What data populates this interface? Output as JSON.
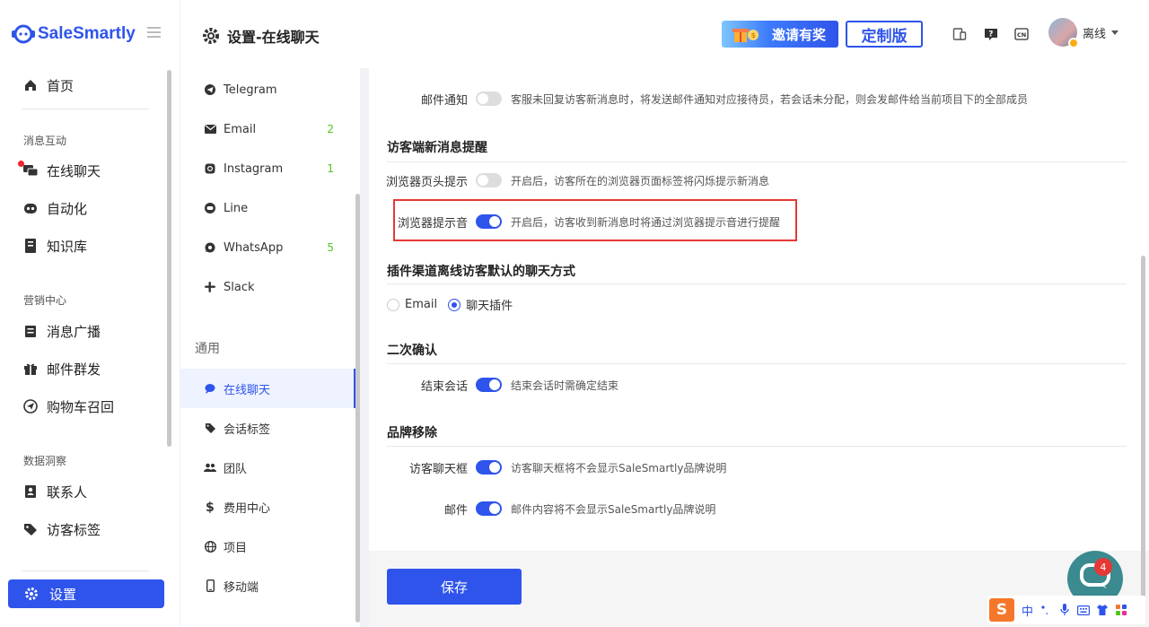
{
  "app": {
    "logo_text": "SaleSmartly",
    "brand_color": "#2f54eb"
  },
  "nav": {
    "home": "首页",
    "section_messaging": "消息互动",
    "live_chat": "在线聊天",
    "automation": "自动化",
    "knowledge": "知识库",
    "section_marketing": "营销中心",
    "broadcast": "消息广播",
    "mass_email": "邮件群发",
    "cart_recovery": "购物车召回",
    "section_data": "数据洞察",
    "contacts": "联系人",
    "visitor_tags": "访客标签",
    "settings": "设置"
  },
  "header": {
    "title": "设置-在线聊天",
    "invite_label": "邀请有奖",
    "custom_label": "定制版",
    "user_status": "离线"
  },
  "submenu": {
    "items": [
      {
        "label": "Telegram",
        "count": ""
      },
      {
        "label": "Email",
        "count": "2"
      },
      {
        "label": "Instagram",
        "count": "1"
      },
      {
        "label": "Line",
        "count": ""
      },
      {
        "label": "WhatsApp",
        "count": "5"
      },
      {
        "label": "Slack",
        "count": ""
      }
    ],
    "general_section": "通用",
    "general": [
      {
        "label": "在线聊天"
      },
      {
        "label": "会话标签"
      },
      {
        "label": "团队"
      },
      {
        "label": "费用中心"
      },
      {
        "label": "项目"
      },
      {
        "label": "移动端"
      }
    ]
  },
  "content": {
    "email_notify": {
      "label": "邮件通知",
      "desc": "客服未回复访客新消息时，将发送邮件通知对应接待员，若会话未分配，则会发邮件给当前项目下的全部成员",
      "on": false
    },
    "visitor_section": "访客端新消息提醒",
    "browser_tab": {
      "label": "浏览器页头提示",
      "desc": "开启后，访客所在的浏览器页面标签将闪烁提示新消息",
      "on": false
    },
    "browser_sound": {
      "label": "浏览器提示音",
      "desc": "开启后，访客收到新消息时将通过浏览器提示音进行提醒",
      "on": true
    },
    "plugin_section": "插件渠道离线访客默认的聊天方式",
    "radio_email": "Email",
    "radio_plugin": "聊天插件",
    "confirm_section": "二次确认",
    "end_chat": {
      "label": "结束会话",
      "desc": "结束会话时需确定结束",
      "on": true
    },
    "brand_section": "品牌移除",
    "visitor_box": {
      "label": "访客聊天框",
      "desc": "访客聊天框将不会显示SaleSmartly品牌说明",
      "on": true
    },
    "mail": {
      "label": "邮件",
      "desc": "邮件内容将不会显示SaleSmartly品牌说明",
      "on": true
    },
    "save_label": "保存"
  },
  "chat_fab": {
    "badge": "4"
  },
  "ime": {
    "logo": "S",
    "mode": "中"
  }
}
